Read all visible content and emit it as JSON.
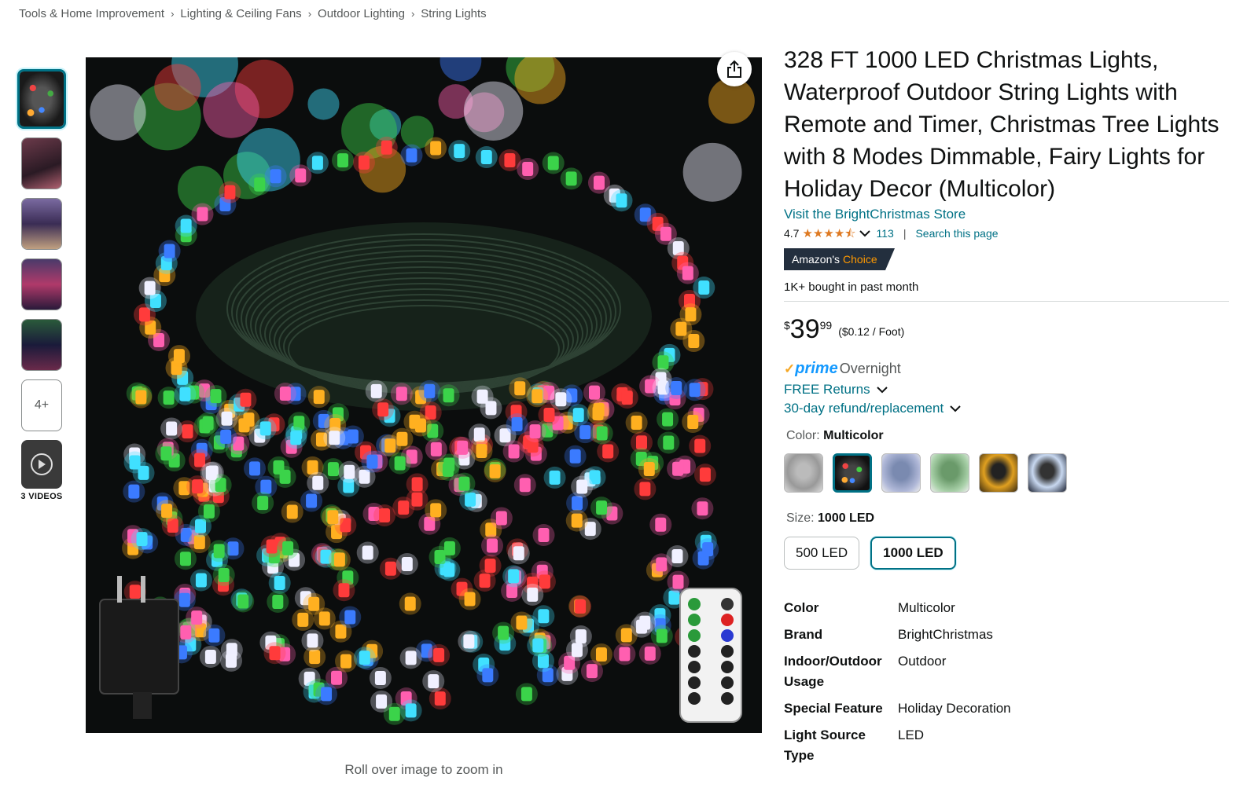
{
  "breadcrumb": [
    "Tools & Home Improvement",
    "Lighting & Ceiling Fans",
    "Outdoor Lighting",
    "String Lights"
  ],
  "gallery": {
    "more_label": "4+",
    "videos_label": "3 VIDEOS",
    "zoom_hint": "Roll over image to zoom in"
  },
  "product": {
    "title": "328 FT 1000 LED Christmas Lights, Waterproof Outdoor String Lights with Remote and Timer, Christmas Tree Lights with 8 Modes Dimmable, Fairy Lights for Holiday Decor (Multicolor)",
    "store_link": "Visit the BrightChristmas Store",
    "rating": "4.7",
    "review_count": "113",
    "search_page": "Search this page",
    "badge_prefix": "Amazon's",
    "badge_choice": "Choice",
    "bought": "1K+ bought in past month"
  },
  "price": {
    "symbol": "$",
    "whole": "39",
    "fraction": "99",
    "unit_price": "($0.12 / Foot)"
  },
  "delivery": {
    "prime_check": "✓",
    "prime_word": "prime",
    "prime_ship": "Overnight",
    "free_returns": "FREE Returns",
    "refund": "30-day refund/replacement"
  },
  "color": {
    "label": "Color: ",
    "selected": "Multicolor"
  },
  "size": {
    "label": "Size: ",
    "selected": "1000 LED",
    "options": [
      "500 LED",
      "1000 LED"
    ]
  },
  "specs": [
    {
      "key": "Color",
      "value": "Multicolor"
    },
    {
      "key": "Brand",
      "value": "BrightChristmas"
    },
    {
      "key": "Indoor/Outdoor Usage",
      "value": "Outdoor"
    },
    {
      "key": "Special Feature",
      "value": "Holiday Decoration"
    },
    {
      "key": "Light Source Type",
      "value": "LED"
    }
  ],
  "colors": {
    "accent": "#007185",
    "star": "#de7921",
    "badge_bg": "#232f3e",
    "prime_blue": "#1399ff"
  }
}
